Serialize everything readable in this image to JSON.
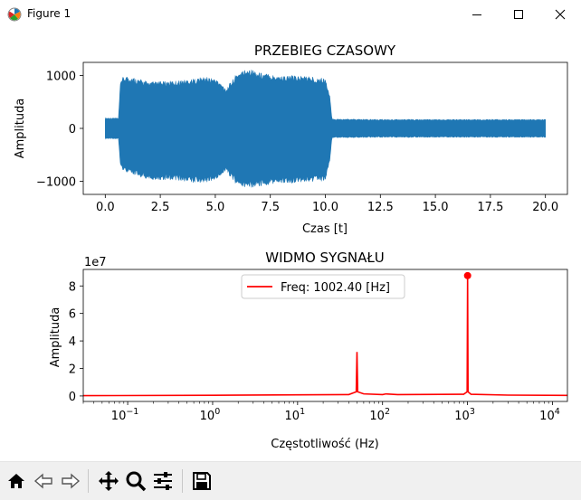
{
  "window": {
    "title": "Figure 1",
    "icons": {
      "app": "matplotlib-icon",
      "minimize": "minimize-icon",
      "maximize": "maximize-icon",
      "close": "close-icon"
    }
  },
  "toolbar": {
    "buttons": [
      {
        "name": "home-icon"
      },
      {
        "name": "back-icon"
      },
      {
        "name": "forward-icon"
      },
      {
        "name": "pan-icon"
      },
      {
        "name": "zoom-icon"
      },
      {
        "name": "configure-subplots-icon"
      },
      {
        "name": "save-icon"
      }
    ]
  },
  "chart_data": [
    {
      "type": "line",
      "title": "PRZEBIEG CZASOWY",
      "xlabel": "Czas [t]",
      "ylabel": "Amplituda",
      "xlim": [
        -1,
        21
      ],
      "ylim": [
        -1250,
        1250
      ],
      "xticks": [
        0.0,
        2.5,
        5.0,
        7.5,
        10.0,
        12.5,
        15.0,
        17.5,
        20.0
      ],
      "xtick_labels": [
        "0.0",
        "2.5",
        "5.0",
        "7.5",
        "10.0",
        "12.5",
        "15.0",
        "17.5",
        "20.0"
      ],
      "yticks": [
        1000,
        0,
        -1000
      ],
      "ytick_labels": [
        "1000",
        "0",
        "−1000"
      ],
      "color": "#1f77b4",
      "envelope": {
        "t": [
          0,
          0.5,
          0.6,
          0.7,
          1.0,
          2,
          3,
          4,
          4.5,
          5,
          5.5,
          6,
          6.5,
          7,
          8,
          9,
          10,
          10.2,
          10.3,
          12,
          15,
          20
        ],
        "upper": [
          200,
          200,
          190,
          950,
          1000,
          880,
          900,
          940,
          980,
          950,
          760,
          1050,
          1150,
          1060,
          1000,
          1000,
          950,
          620,
          180,
          170,
          170,
          170
        ],
        "lower": [
          -200,
          -200,
          -190,
          -750,
          -850,
          -970,
          -980,
          -1030,
          -1030,
          -990,
          -820,
          -1080,
          -1150,
          -1100,
          -1050,
          -1020,
          -1000,
          -620,
          -180,
          -170,
          -170,
          -170
        ]
      },
      "grid": false
    },
    {
      "type": "line",
      "title": "WIDMO SYGNAŁU",
      "xlabel": "Częstotliwość (Hz)",
      "ylabel": "Amplituda",
      "yscale_label": "1e7",
      "xscale": "log",
      "xlim": [
        0.03,
        15000
      ],
      "ylim": [
        -0.4,
        9.2
      ],
      "xticks": [
        0.1,
        1,
        10,
        100,
        1000,
        10000
      ],
      "xtick_bases": [
        "10",
        "10",
        "10",
        "10",
        "10",
        "10"
      ],
      "xtick_exps": [
        "−1",
        "0",
        "1",
        "2",
        "3",
        "4"
      ],
      "yticks": [
        0,
        2,
        4,
        6,
        8
      ],
      "ytick_labels": [
        "0",
        "2",
        "4",
        "6",
        "8"
      ],
      "color": "#ff0000",
      "series": [
        {
          "name": "Freq: 1002.40 [Hz]",
          "x": [
            0.03,
            1,
            10,
            40,
            49,
            50,
            51,
            60,
            100,
            110,
            150,
            900,
            990,
            1002.4,
            1015,
            1100,
            3000,
            15000
          ],
          "y": [
            0.02,
            0.05,
            0.08,
            0.1,
            0.3,
            3.2,
            0.3,
            0.15,
            0.1,
            0.15,
            0.1,
            0.12,
            0.3,
            8.75,
            0.3,
            0.12,
            0.06,
            0.04
          ]
        }
      ],
      "peak": {
        "x": 1002.4,
        "y": 8.75
      },
      "legend": "top-center",
      "grid": false
    }
  ]
}
